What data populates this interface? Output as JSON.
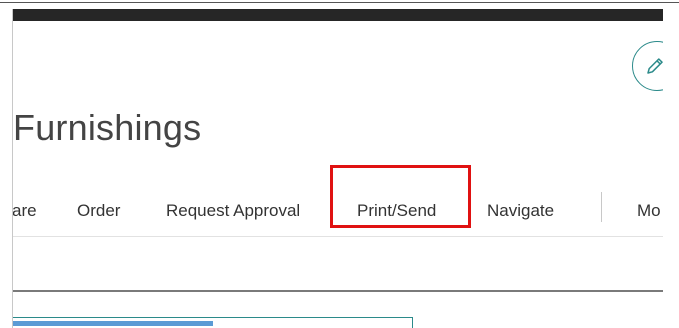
{
  "page": {
    "title": "Furnishings"
  },
  "actions": {
    "share": "are",
    "order": "Order",
    "request_approval": "Request Approval",
    "print_send": "Print/Send",
    "navigate": "Navigate",
    "more": "Mo"
  },
  "icons": {
    "edit": "pencil-icon"
  },
  "colors": {
    "accent": "#2b8a8a",
    "highlight": "#e01111",
    "progress": "#5b9bd5"
  }
}
